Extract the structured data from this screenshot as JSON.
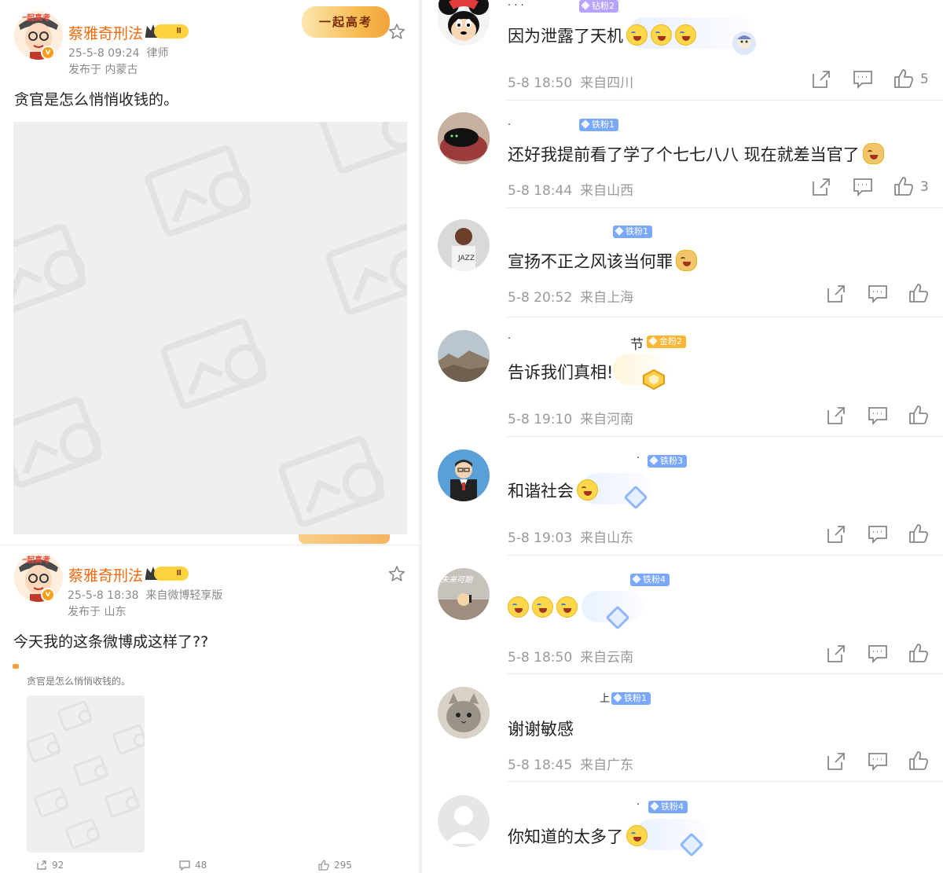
{
  "posts": [
    {
      "author": "蔡雅奇刑法",
      "level": "Ⅱ",
      "time": "25-5-8 09:24",
      "tag": "律师",
      "location": "发布于 内蒙古",
      "text": "贪官是怎么悄悄收钱的。",
      "banner": "一起高考"
    },
    {
      "author": "蔡雅奇刑法",
      "level": "Ⅱ",
      "time": "25-5-8 18:38",
      "tag": "来自微博轻享版",
      "location": "发布于 山东",
      "text": "今天我的这条微博成这样了??",
      "quoted_text": "贪官是怎么悄悄收钱的。",
      "reposts": "92",
      "comments": "48",
      "likes": "295"
    }
  ],
  "comments": [
    {
      "badge": "钻粉2",
      "badge_color": "#b7a3ff",
      "text": "因为泄露了天机",
      "time": "5-8 18:50",
      "source": "来自四川",
      "likes": "5",
      "emoji": [
        "cry",
        "cry",
        "cry"
      ]
    },
    {
      "badge": "铁粉1",
      "badge_color": "#7aa8ff",
      "text": "还好我提前看了学了个七七八八 现在就差当官了",
      "time": "5-8 18:44",
      "source": "来自山西",
      "likes": "3",
      "emoji": [
        "dog"
      ]
    },
    {
      "badge": "铁粉1",
      "badge_color": "#7aa8ff",
      "text": "宣扬不正之风该当何罪",
      "time": "5-8 20:52",
      "source": "来自上海",
      "likes": "",
      "emoji": [
        "dog"
      ]
    },
    {
      "badge": "金粉2",
      "badge_color": "#ffb637",
      "name_tail": "节",
      "text": "告诉我们真相!",
      "time": "5-8 19:10",
      "source": "来自河南",
      "likes": "",
      "emoji": []
    },
    {
      "badge": "铁粉3",
      "badge_color": "#7aa8ff",
      "text": "和谐社会",
      "time": "5-8 19:03",
      "source": "来自山东",
      "likes": "",
      "emoji": [
        "grin"
      ]
    },
    {
      "badge": "铁粉4",
      "badge_color": "#7aa8ff",
      "text": "",
      "time": "5-8 18:50",
      "source": "来自云南",
      "likes": "",
      "emoji": [
        "cry",
        "cry",
        "cry"
      ]
    },
    {
      "badge": "铁粉1",
      "badge_color": "#7aa8ff",
      "text": "谢谢敏感",
      "time": "5-8 18:45",
      "source": "来自广东",
      "likes": "",
      "emoji": []
    },
    {
      "badge": "铁粉4",
      "badge_color": "#7aa8ff",
      "text": "你知道的太多了",
      "time": "",
      "source": "",
      "likes": "",
      "emoji": [
        "cry"
      ]
    }
  ],
  "icons": {
    "share": "share-icon",
    "comment": "comment-icon",
    "like": "thumbs-up-icon",
    "star": "star-icon"
  },
  "colors": {
    "author": "#f26b10",
    "meta": "#9a9a9a",
    "fan_badge": "#7aa8ff"
  }
}
